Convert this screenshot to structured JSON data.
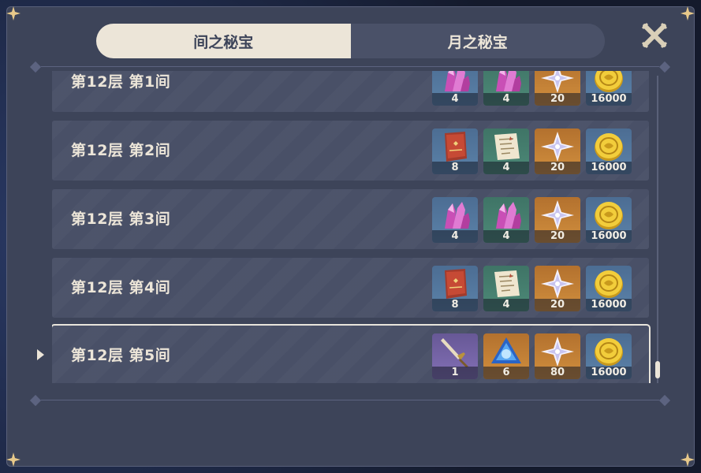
{
  "tabs": [
    {
      "label": "间之秘宝",
      "active": true
    },
    {
      "label": "月之秘宝",
      "active": false
    }
  ],
  "rows": [
    {
      "title": "第12层 第1间",
      "rewards": [
        {
          "icon": "crystal-chunk-icon",
          "bg": "blue",
          "qty": "4"
        },
        {
          "icon": "crystal-chunk-icon",
          "bg": "green",
          "qty": "4"
        },
        {
          "icon": "primogem-icon",
          "bg": "orange",
          "qty": "20"
        },
        {
          "icon": "mora-coin-icon",
          "bg": "blue",
          "qty": "16000"
        }
      ]
    },
    {
      "title": "第12层 第2间",
      "rewards": [
        {
          "icon": "red-book-icon",
          "bg": "blue",
          "qty": "8"
        },
        {
          "icon": "scroll-note-icon",
          "bg": "green",
          "qty": "4"
        },
        {
          "icon": "primogem-icon",
          "bg": "orange",
          "qty": "20"
        },
        {
          "icon": "mora-coin-icon",
          "bg": "blue",
          "qty": "16000"
        }
      ]
    },
    {
      "title": "第12层 第3间",
      "rewards": [
        {
          "icon": "crystal-chunk-icon",
          "bg": "blue",
          "qty": "4"
        },
        {
          "icon": "crystal-chunk-icon",
          "bg": "green",
          "qty": "4"
        },
        {
          "icon": "primogem-icon",
          "bg": "orange",
          "qty": "20"
        },
        {
          "icon": "mora-coin-icon",
          "bg": "blue",
          "qty": "16000"
        }
      ]
    },
    {
      "title": "第12层 第4间",
      "rewards": [
        {
          "icon": "red-book-icon",
          "bg": "blue",
          "qty": "8"
        },
        {
          "icon": "scroll-note-icon",
          "bg": "green",
          "qty": "4"
        },
        {
          "icon": "primogem-icon",
          "bg": "orange",
          "qty": "20"
        },
        {
          "icon": "mora-coin-icon",
          "bg": "blue",
          "qty": "16000"
        }
      ]
    },
    {
      "title": "第12层 第5间",
      "selected": true,
      "rewards": [
        {
          "icon": "dagger-icon",
          "bg": "purple",
          "qty": "1"
        },
        {
          "icon": "blue-gem-icon",
          "bg": "orange",
          "qty": "6"
        },
        {
          "icon": "primogem-icon",
          "bg": "orange",
          "qty": "80"
        },
        {
          "icon": "mora-coin-icon",
          "bg": "blue",
          "qty": "16000"
        }
      ]
    }
  ],
  "colors": {
    "panel": "#3d4459",
    "row": "#495067",
    "tab_active": "#ece5d8",
    "text": "#ece5d8"
  }
}
